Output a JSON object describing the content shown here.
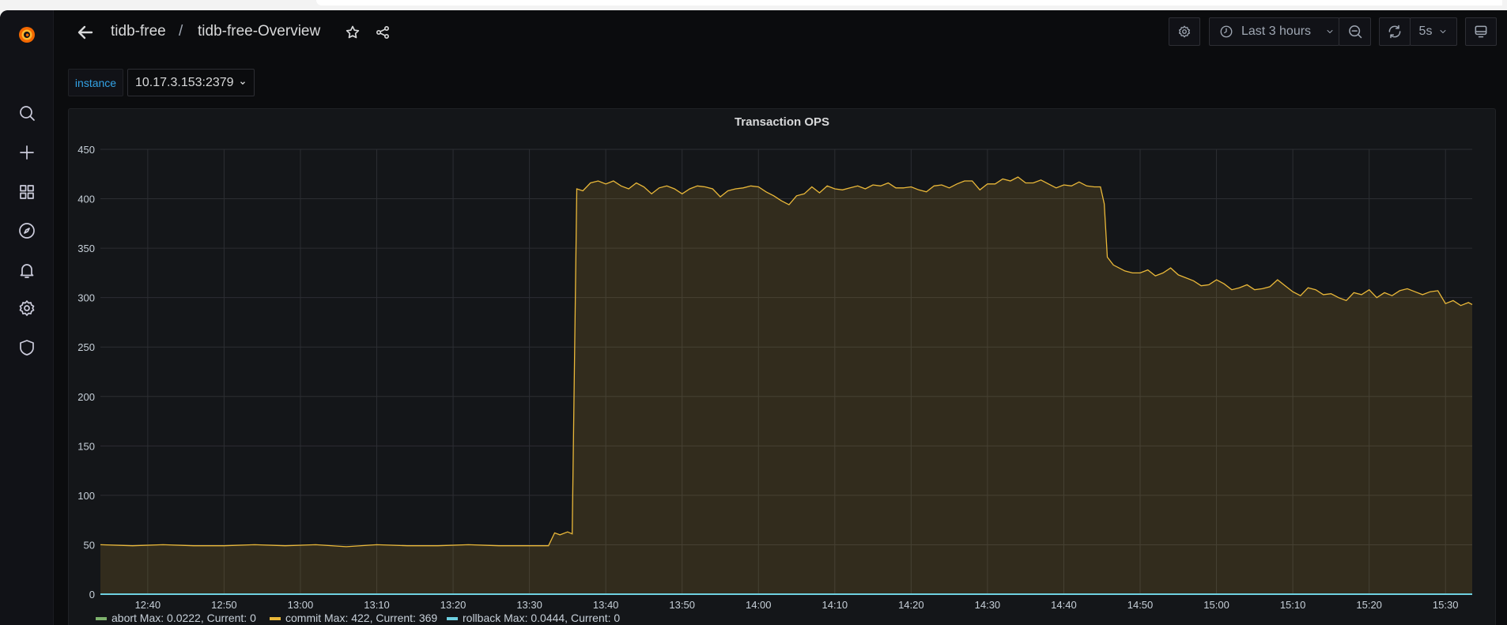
{
  "header": {
    "breadcrumb_folder": "tidb-free",
    "separator": "/",
    "dashboard_title": "tidb-free-Overview",
    "time_range": "Last 3 hours",
    "refresh_interval": "5s"
  },
  "variables": {
    "instance_label": "instance",
    "instance_value": "10.17.3.153:2379"
  },
  "panel": {
    "title": "Transaction OPS"
  },
  "chart_data": {
    "type": "area",
    "title": "Transaction OPS",
    "xlabel": "",
    "ylabel": "",
    "x_unit": "minutes after 12:00",
    "xlim": [
      33.8,
      213.5
    ],
    "ylim": [
      0,
      450
    ],
    "yticks": [
      "0",
      "50",
      "100",
      "150",
      "200",
      "250",
      "300",
      "350",
      "400",
      "450"
    ],
    "xticks": [
      {
        "label": "12:40",
        "x": 40
      },
      {
        "label": "12:50",
        "x": 50
      },
      {
        "label": "13:00",
        "x": 60
      },
      {
        "label": "13:10",
        "x": 70
      },
      {
        "label": "13:20",
        "x": 80
      },
      {
        "label": "13:30",
        "x": 90
      },
      {
        "label": "13:40",
        "x": 100
      },
      {
        "label": "13:50",
        "x": 110
      },
      {
        "label": "14:00",
        "x": 120
      },
      {
        "label": "14:10",
        "x": 130
      },
      {
        "label": "14:20",
        "x": 140
      },
      {
        "label": "14:30",
        "x": 150
      },
      {
        "label": "14:40",
        "x": 160
      },
      {
        "label": "14:50",
        "x": 170
      },
      {
        "label": "15:00",
        "x": 180
      },
      {
        "label": "15:10",
        "x": 190
      },
      {
        "label": "15:20",
        "x": 200
      },
      {
        "label": "15:30",
        "x": 210
      }
    ],
    "grid": true,
    "legend_position": "bottom",
    "series": [
      {
        "name": "abort",
        "legend": "abort  Max: 0.0222, Current: 0",
        "color": "#7eb26d",
        "points": [
          [
            33.8,
            0
          ],
          [
            213.5,
            0
          ]
        ]
      },
      {
        "name": "commit",
        "legend": "commit  Max: 422, Current: 369",
        "color": "#eab839",
        "points": [
          [
            33.8,
            50
          ],
          [
            38,
            49
          ],
          [
            42,
            50
          ],
          [
            46,
            49
          ],
          [
            50,
            49
          ],
          [
            54,
            50
          ],
          [
            58,
            49
          ],
          [
            62,
            50
          ],
          [
            66,
            48
          ],
          [
            70,
            50
          ],
          [
            74,
            49
          ],
          [
            78,
            49
          ],
          [
            82,
            50
          ],
          [
            86,
            49
          ],
          [
            90,
            49
          ],
          [
            92.5,
            49
          ],
          [
            93.3,
            62
          ],
          [
            94,
            60
          ],
          [
            95,
            63
          ],
          [
            95.6,
            61
          ],
          [
            96.2,
            410
          ],
          [
            97,
            408
          ],
          [
            98,
            416
          ],
          [
            99,
            418
          ],
          [
            100,
            415
          ],
          [
            101,
            418
          ],
          [
            102,
            413
          ],
          [
            103,
            410
          ],
          [
            104,
            416
          ],
          [
            105,
            412
          ],
          [
            106,
            405
          ],
          [
            107,
            411
          ],
          [
            108,
            413
          ],
          [
            109,
            410
          ],
          [
            110,
            405
          ],
          [
            111,
            410
          ],
          [
            112,
            413
          ],
          [
            113,
            412
          ],
          [
            114,
            410
          ],
          [
            115,
            402
          ],
          [
            116,
            408
          ],
          [
            117,
            410
          ],
          [
            118,
            411
          ],
          [
            119,
            413
          ],
          [
            120,
            412
          ],
          [
            121,
            407
          ],
          [
            122,
            403
          ],
          [
            123,
            398
          ],
          [
            124,
            394
          ],
          [
            125,
            403
          ],
          [
            126,
            405
          ],
          [
            127,
            412
          ],
          [
            128,
            406
          ],
          [
            129,
            413
          ],
          [
            130,
            410
          ],
          [
            131,
            409
          ],
          [
            132,
            411
          ],
          [
            133,
            413
          ],
          [
            134,
            410
          ],
          [
            135,
            414
          ],
          [
            136,
            413
          ],
          [
            137,
            416
          ],
          [
            138,
            411
          ],
          [
            139,
            411
          ],
          [
            140,
            412
          ],
          [
            141,
            409
          ],
          [
            142,
            407
          ],
          [
            143,
            413
          ],
          [
            144,
            414
          ],
          [
            145,
            411
          ],
          [
            146,
            415
          ],
          [
            147,
            418
          ],
          [
            148,
            418
          ],
          [
            149,
            409
          ],
          [
            150,
            415
          ],
          [
            151,
            415
          ],
          [
            152,
            420
          ],
          [
            153,
            418
          ],
          [
            154,
            422
          ],
          [
            155,
            416
          ],
          [
            156,
            416
          ],
          [
            157,
            419
          ],
          [
            158,
            415
          ],
          [
            159,
            411
          ],
          [
            160,
            414
          ],
          [
            161,
            413
          ],
          [
            162,
            417
          ],
          [
            163,
            413
          ],
          [
            164,
            412
          ],
          [
            164.8,
            412
          ],
          [
            165.3,
            395
          ],
          [
            165.7,
            341
          ],
          [
            166.5,
            333
          ],
          [
            168,
            327
          ],
          [
            169,
            325
          ],
          [
            170,
            325
          ],
          [
            171,
            328
          ],
          [
            172,
            322
          ],
          [
            173,
            325
          ],
          [
            174,
            330
          ],
          [
            175,
            323
          ],
          [
            176,
            320
          ],
          [
            177,
            317
          ],
          [
            178,
            312
          ],
          [
            179,
            313
          ],
          [
            180,
            318
          ],
          [
            181,
            314
          ],
          [
            182,
            308
          ],
          [
            183,
            310
          ],
          [
            184,
            313
          ],
          [
            185,
            308
          ],
          [
            186,
            309
          ],
          [
            187,
            311
          ],
          [
            188,
            318
          ],
          [
            189,
            312
          ],
          [
            190,
            306
          ],
          [
            191,
            302
          ],
          [
            192,
            310
          ],
          [
            193,
            308
          ],
          [
            194,
            303
          ],
          [
            195,
            304
          ],
          [
            196,
            300
          ],
          [
            197,
            297
          ],
          [
            198,
            305
          ],
          [
            199,
            303
          ],
          [
            200,
            308
          ],
          [
            201,
            300
          ],
          [
            202,
            305
          ],
          [
            203,
            302
          ],
          [
            204,
            307
          ],
          [
            205,
            309
          ],
          [
            206,
            306
          ],
          [
            207,
            303
          ],
          [
            208,
            306
          ],
          [
            209,
            307
          ],
          [
            210,
            294
          ],
          [
            211,
            297
          ],
          [
            212,
            292
          ],
          [
            213,
            295
          ],
          [
            213.5,
            293
          ]
        ]
      },
      {
        "name": "rollback",
        "legend": "rollback  Max: 0.0444, Current: 0",
        "color": "#6ed0e0",
        "points": [
          [
            33.8,
            0
          ],
          [
            213.5,
            0
          ]
        ]
      }
    ]
  }
}
